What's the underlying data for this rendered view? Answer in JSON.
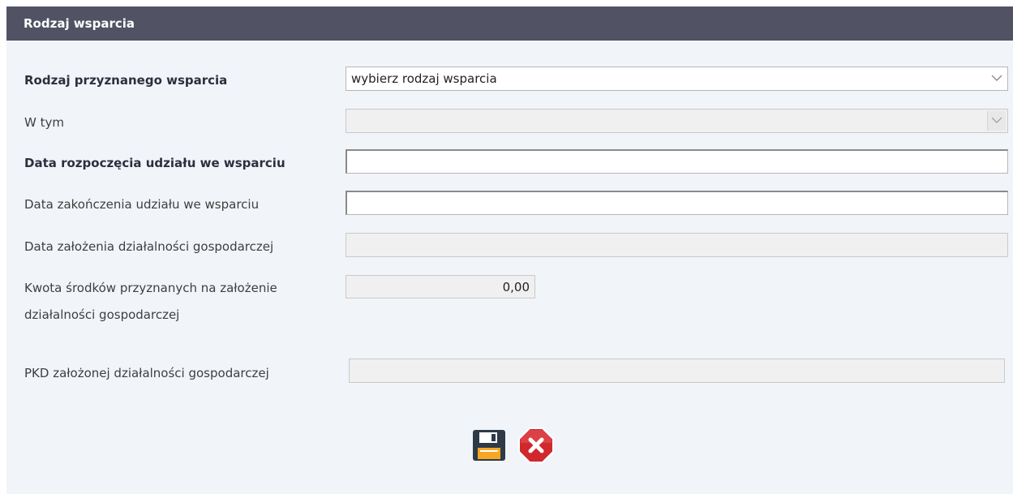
{
  "panel": {
    "title": "Rodzaj wsparcia"
  },
  "form": {
    "support_type": {
      "label": "Rodzaj przyznanego wsparcia",
      "value": "wybierz rodzaj wsparcia"
    },
    "including": {
      "label": "W tym",
      "value": ""
    },
    "start_date": {
      "label": "Data rozpoczęcia udziału we wsparciu",
      "value": ""
    },
    "end_date": {
      "label": "Data zakończenia udziału we wsparciu",
      "value": ""
    },
    "business_founded_date": {
      "label": "Data założenia działalności gospodarczej",
      "value": ""
    },
    "funds_amount": {
      "label_line1": "Kwota środków przyznanych na założenie",
      "label_line2": "działalności gospodarczej",
      "value": "0,00"
    },
    "pkd": {
      "label": "PKD założonej działalności gospodarczej",
      "value": ""
    }
  },
  "actions": {
    "save_icon": "floppy-disk-icon",
    "cancel_icon": "red-x-octagon-icon"
  },
  "colors": {
    "header": "#515263",
    "panel_bg": "#f1f5fa",
    "cancel_red": "#d0282c",
    "save_dark": "#2e3a48",
    "save_orange": "#f6a623"
  }
}
